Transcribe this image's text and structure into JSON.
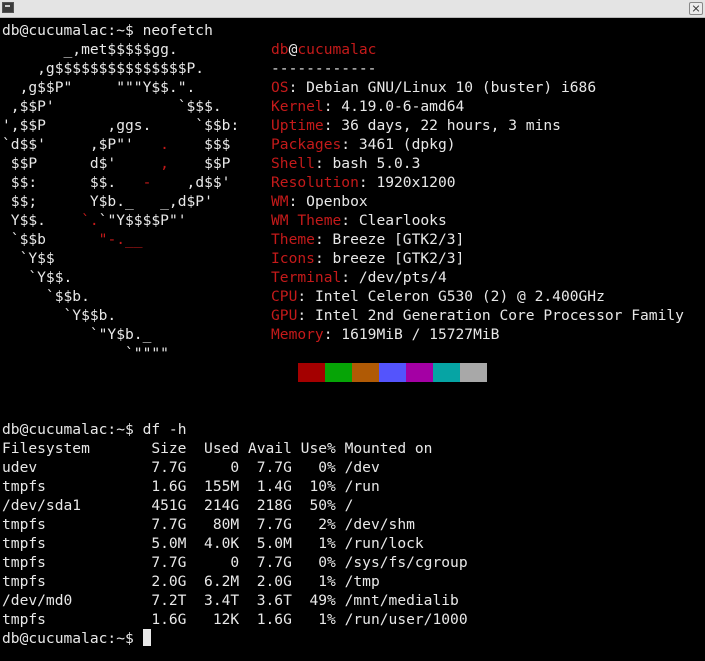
{
  "window": {
    "icon": "terminal-icon",
    "close_icon": "close-icon"
  },
  "prompt1": "db@cucumalac:~$ neofetch",
  "logo_lines": [
    [
      {
        "t": "       _,met$$$$$gg.",
        "c": "white"
      }
    ],
    [
      {
        "t": "    ,g$$$$$$$$$$$$$$$P.",
        "c": "white"
      }
    ],
    [
      {
        "t": "  ,g$$P\"     \"\"\"Y$$.\".",
        "c": "white"
      }
    ],
    [
      {
        "t": " ,$$P'              `$$$.",
        "c": "white"
      }
    ],
    [
      {
        "t": "',$$P       ,ggs.     `$$b:",
        "c": "white"
      }
    ],
    [
      {
        "t": "`d$$'     ,$P\"'   ",
        "c": "white"
      },
      {
        "t": ".",
        "c": "red"
      },
      {
        "t": "    $$$",
        "c": "white"
      }
    ],
    [
      {
        "t": " $$P      d$'     ",
        "c": "white"
      },
      {
        "t": ",",
        "c": "red"
      },
      {
        "t": "    $$P",
        "c": "white"
      }
    ],
    [
      {
        "t": " $$:      $$.   ",
        "c": "white"
      },
      {
        "t": "-",
        "c": "red"
      },
      {
        "t": "    ,d$$'",
        "c": "white"
      }
    ],
    [
      {
        "t": " $$;      Y$b._   _,d$P'",
        "c": "white"
      }
    ],
    [
      {
        "t": " Y$$.    ",
        "c": "white"
      },
      {
        "t": "`.",
        "c": "red"
      },
      {
        "t": "`\"Y$$$$P\"'",
        "c": "white"
      }
    ],
    [
      {
        "t": " `$$b      ",
        "c": "white"
      },
      {
        "t": "\"-.__",
        "c": "red"
      }
    ],
    [
      {
        "t": "  `Y$$",
        "c": "white"
      }
    ],
    [
      {
        "t": "   `Y$$.",
        "c": "white"
      }
    ],
    [
      {
        "t": "     `$$b.",
        "c": "white"
      }
    ],
    [
      {
        "t": "       `Y$$b.",
        "c": "white"
      }
    ],
    [
      {
        "t": "          `\"Y$b._",
        "c": "white"
      }
    ],
    [
      {
        "t": "              `\"\"\"\"",
        "c": "white"
      }
    ]
  ],
  "info": {
    "user": "db",
    "at": "@",
    "host": "cucumalac",
    "separator": "------------",
    "fields": [
      {
        "label": "OS",
        "value": "Debian GNU/Linux 10 (buster) i686"
      },
      {
        "label": "Kernel",
        "value": "4.19.0-6-amd64"
      },
      {
        "label": "Uptime",
        "value": "36 days, 22 hours, 3 mins"
      },
      {
        "label": "Packages",
        "value": "3461 (dpkg)"
      },
      {
        "label": "Shell",
        "value": "bash 5.0.3"
      },
      {
        "label": "Resolution",
        "value": "1920x1200"
      },
      {
        "label": "WM",
        "value": "Openbox"
      },
      {
        "label": "WM Theme",
        "value": "Clearlooks"
      },
      {
        "label": "Theme",
        "value": "Breeze [GTK2/3]"
      },
      {
        "label": "Icons",
        "value": "breeze [GTK2/3]"
      },
      {
        "label": "Terminal",
        "value": "/dev/pts/4"
      },
      {
        "label": "CPU",
        "value": "Intel Celeron G530 (2) @ 2.400GHz"
      },
      {
        "label": "GPU",
        "value": "Intel 2nd Generation Core Processor Family"
      },
      {
        "label": "Memory",
        "value": "1619MiB / 15727MiB"
      }
    ],
    "palette": [
      "#a40000",
      "#06a406",
      "#b05a05",
      "#5454fc",
      "#a400a4",
      "#06a4a4",
      "#a8a8a8"
    ]
  },
  "prompt2": "db@cucumalac:~$ df -h",
  "df": {
    "headers": [
      "Filesystem",
      "Size",
      "Used",
      "Avail",
      "Use%",
      "Mounted on"
    ],
    "rows": [
      [
        "udev",
        "7.7G",
        "0",
        "7.7G",
        "0%",
        "/dev"
      ],
      [
        "tmpfs",
        "1.6G",
        "155M",
        "1.4G",
        "10%",
        "/run"
      ],
      [
        "/dev/sda1",
        "451G",
        "214G",
        "218G",
        "50%",
        "/"
      ],
      [
        "tmpfs",
        "7.7G",
        "80M",
        "7.7G",
        "2%",
        "/dev/shm"
      ],
      [
        "tmpfs",
        "5.0M",
        "4.0K",
        "5.0M",
        "1%",
        "/run/lock"
      ],
      [
        "tmpfs",
        "7.7G",
        "0",
        "7.7G",
        "0%",
        "/sys/fs/cgroup"
      ],
      [
        "tmpfs",
        "2.0G",
        "6.2M",
        "2.0G",
        "1%",
        "/tmp"
      ],
      [
        "/dev/md0",
        "7.2T",
        "3.4T",
        "3.6T",
        "49%",
        "/mnt/medialib"
      ],
      [
        "tmpfs",
        "1.6G",
        "12K",
        "1.6G",
        "1%",
        "/run/user/1000"
      ]
    ]
  },
  "prompt3": "db@cucumalac:~$ "
}
